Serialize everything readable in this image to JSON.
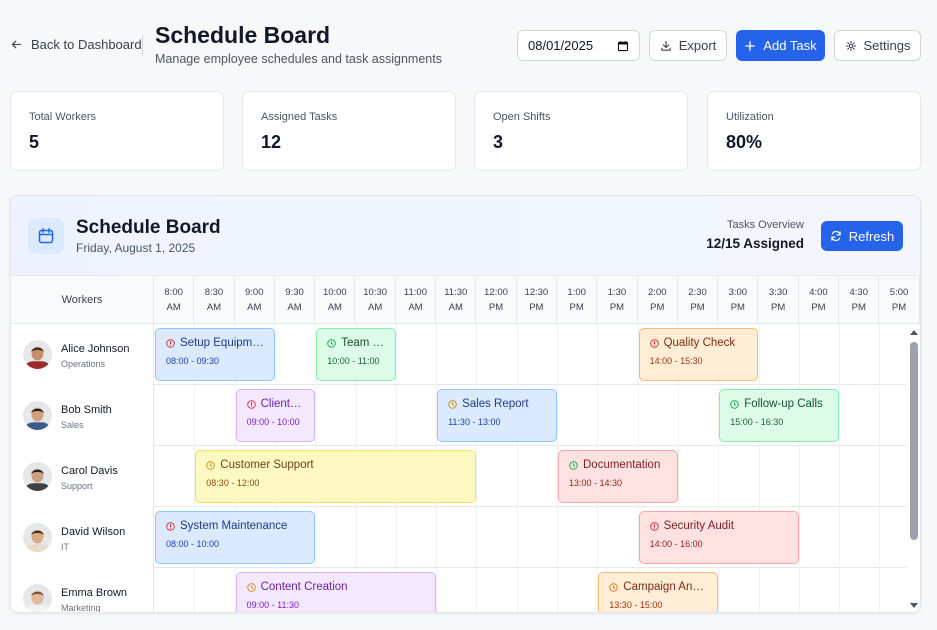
{
  "header": {
    "back_label": "Back to Dashboard",
    "title": "Schedule Board",
    "subtitle": "Manage employee schedules and task assignments",
    "date_value": "08/01/2025",
    "export_label": "Export",
    "add_task_label": "Add Task",
    "settings_label": "Settings"
  },
  "stats": [
    {
      "label": "Total Workers",
      "value": "5"
    },
    {
      "label": "Assigned Tasks",
      "value": "12"
    },
    {
      "label": "Open Shifts",
      "value": "3"
    },
    {
      "label": "Utilization",
      "value": "80%"
    }
  ],
  "board": {
    "title": "Schedule Board",
    "date": "Friday, August 1, 2025",
    "overview_label": "Tasks Overview",
    "overview_value": "12/15 Assigned",
    "refresh_label": "Refresh",
    "workers_header": "Workers"
  },
  "times": [
    [
      "8:00",
      "AM"
    ],
    [
      "8:30",
      "AM"
    ],
    [
      "9:00",
      "AM"
    ],
    [
      "9:30",
      "AM"
    ],
    [
      "10:00",
      "AM"
    ],
    [
      "10:30",
      "AM"
    ],
    [
      "11:00",
      "AM"
    ],
    [
      "11:30",
      "AM"
    ],
    [
      "12:00",
      "PM"
    ],
    [
      "12:30",
      "PM"
    ],
    [
      "1:00",
      "PM"
    ],
    [
      "1:30",
      "PM"
    ],
    [
      "2:00",
      "PM"
    ],
    [
      "2:30",
      "PM"
    ],
    [
      "3:00",
      "PM"
    ],
    [
      "3:30",
      "PM"
    ],
    [
      "4:00",
      "PM"
    ],
    [
      "4:30",
      "PM"
    ],
    [
      "5:00",
      "PM"
    ]
  ],
  "workers": [
    {
      "name": "Alice Johnson",
      "dept": "Operations",
      "avatar": {
        "skin": "#c68e68",
        "hair": "#3b2a1f",
        "shirt": "#9b2c2c"
      },
      "tasks": [
        {
          "title": "Setup Equipment",
          "time": "08:00 - 09:30",
          "color": "blue",
          "icon": "alert-icon",
          "start": "08:00",
          "end": "09:30"
        },
        {
          "title": "Team Meeting",
          "time": "10:00 - 11:00",
          "color": "green",
          "icon": "clock-icon",
          "start": "10:00",
          "end": "11:00"
        },
        {
          "title": "Quality Check",
          "time": "14:00 - 15:30",
          "color": "orange",
          "icon": "alert-icon",
          "start": "14:00",
          "end": "15:30"
        }
      ]
    },
    {
      "name": "Bob Smith",
      "dept": "Sales",
      "avatar": {
        "skin": "#d2a07e",
        "hair": "#2b1d14",
        "shirt": "#3b5b8a"
      },
      "tasks": [
        {
          "title": "Client Call",
          "time": "09:00 - 10:00",
          "color": "purple",
          "icon": "alert-icon",
          "start": "09:00",
          "end": "10:00"
        },
        {
          "title": "Sales Report",
          "time": "11:30 - 13:00",
          "color": "blue",
          "icon": "clock-icon",
          "start": "11:30",
          "end": "13:00"
        },
        {
          "title": "Follow-up Calls",
          "time": "15:00 - 16:30",
          "color": "green",
          "icon": "clock-icon",
          "start": "15:00",
          "end": "16:30"
        }
      ]
    },
    {
      "name": "Carol Davis",
      "dept": "Support",
      "avatar": {
        "skin": "#c9a082",
        "hair": "#2a211b",
        "shirt": "#3f3f46"
      },
      "tasks": [
        {
          "title": "Customer Support",
          "time": "08:30 - 12:00",
          "color": "yellow",
          "icon": "clock-icon",
          "start": "08:30",
          "end": "12:00"
        },
        {
          "title": "Documentation",
          "time": "13:00 - 14:30",
          "color": "red",
          "icon": "clock-icon",
          "start": "13:00",
          "end": "14:30"
        }
      ]
    },
    {
      "name": "David Wilson",
      "dept": "IT",
      "avatar": {
        "skin": "#d7ab86",
        "hair": "#4a2f1c",
        "shirt": "#e7dccb"
      },
      "tasks": [
        {
          "title": "System Maintenance",
          "time": "08:00 - 10:00",
          "color": "blue",
          "icon": "alert-icon",
          "start": "08:00",
          "end": "10:00"
        },
        {
          "title": "Security Audit",
          "time": "14:00 - 16:00",
          "color": "red",
          "icon": "alert-icon",
          "start": "14:00",
          "end": "16:00"
        }
      ]
    },
    {
      "name": "Emma Brown",
      "dept": "Marketing",
      "avatar": {
        "skin": "#e2b99a",
        "hair": "#7a5230",
        "shirt": "#f3f4f6"
      },
      "tasks": [
        {
          "title": "Content Creation",
          "time": "09:00 - 11:30",
          "color": "purple",
          "icon": "clock-icon",
          "start": "09:00",
          "end": "11:30"
        },
        {
          "title": "Campaign Analysis",
          "time": "13:30 - 15:00",
          "color": "orange",
          "icon": "clock-icon",
          "start": "13:30",
          "end": "15:00"
        }
      ]
    }
  ]
}
